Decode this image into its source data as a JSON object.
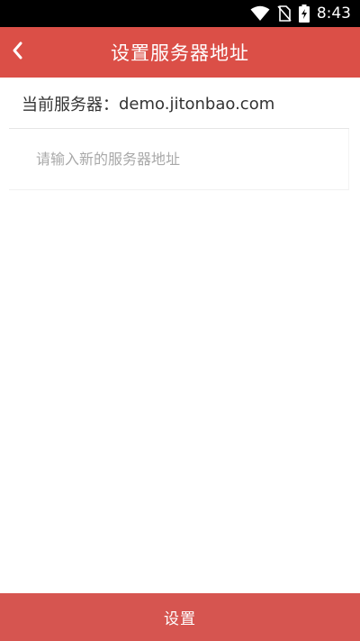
{
  "status_bar": {
    "time": "8:43",
    "icons": [
      "wifi-icon",
      "no-sim-icon",
      "battery-charging-icon"
    ]
  },
  "app_bar": {
    "title": "设置服务器地址",
    "back_icon": "chevron-left-icon"
  },
  "current_server": {
    "label": "当前服务器：",
    "value": "demo.jitonbao.com"
  },
  "new_server_input": {
    "value": "",
    "placeholder": "请输入新的服务器地址"
  },
  "footer": {
    "set_label": "设置"
  },
  "colors": {
    "header": "#db4f47",
    "button": "#d65550",
    "status_bar": "#000000"
  }
}
